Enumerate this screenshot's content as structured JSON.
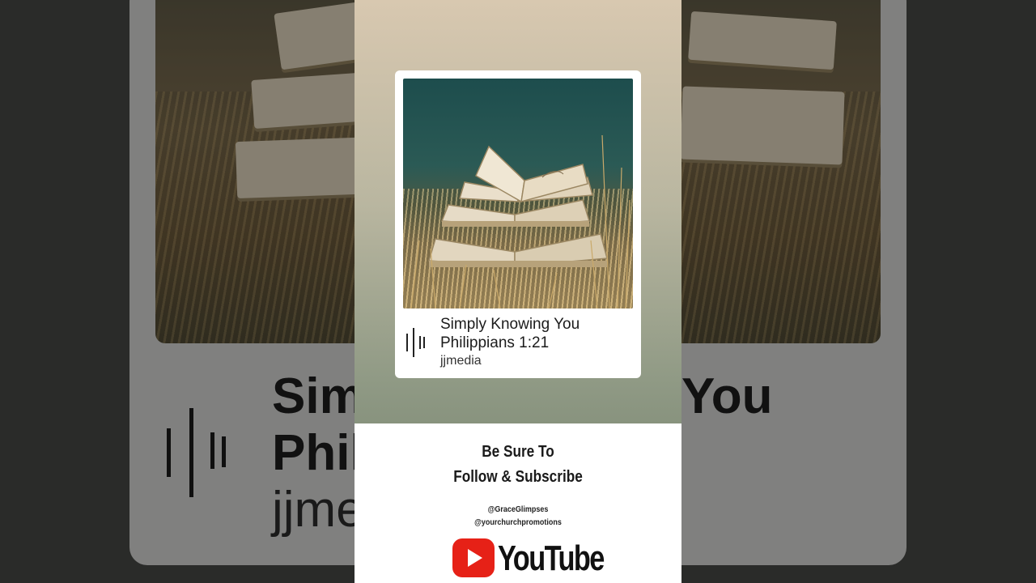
{
  "card": {
    "title": "Simply Knowing You Philippians 1:21",
    "artist": "jjmedia",
    "artwork_icon": "open-books-in-grass"
  },
  "background_card": {
    "title_left": "Sim",
    "title_right": "You",
    "title_line2": "Phil",
    "artist": "jjme"
  },
  "promo": {
    "line1": "Be Sure To",
    "line2": "Follow & Subscribe",
    "handle1": "@GraceGlimpses",
    "handle2": "@yourchurchpromotions",
    "brand": "YouTube",
    "brand_color": "#e62117"
  },
  "icons": {
    "audio": "sound-wave-icon",
    "youtube": "youtube-play-icon"
  }
}
